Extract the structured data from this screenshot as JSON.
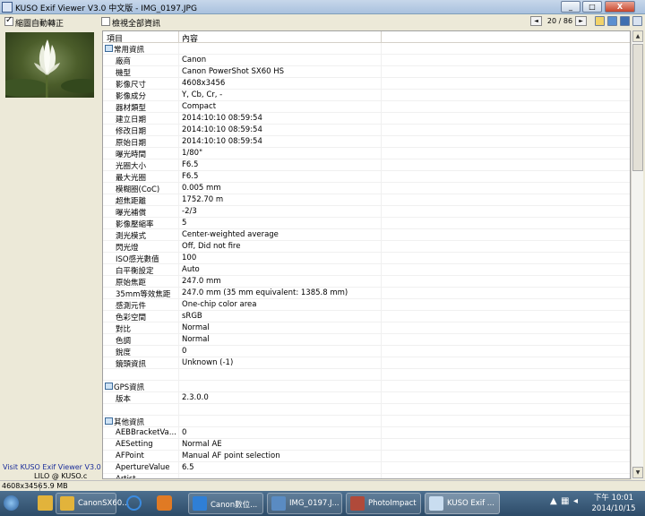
{
  "window": {
    "title": "KUSO Exif Viewer V3.0 中文版 - IMG_0197.JPG",
    "buttons": [
      "_",
      "□",
      "X"
    ]
  },
  "toolbar": {
    "auto_fit_label": "縮圖自動轉正",
    "show_all_label": "檢視全部資訊",
    "page_indicator": "20 / 86",
    "prev_label": "◄",
    "next_label": "►"
  },
  "table": {
    "headers": [
      "項目",
      "內容"
    ],
    "rows": [
      {
        "k": "常用資訊",
        "v": "",
        "section": true
      },
      {
        "k": "廠商",
        "v": "Canon"
      },
      {
        "k": "機型",
        "v": "Canon PowerShot SX60 HS"
      },
      {
        "k": "影像尺寸",
        "v": "4608x3456"
      },
      {
        "k": "影像成分",
        "v": "Y, Cb, Cr, -"
      },
      {
        "k": "器材類型",
        "v": "Compact"
      },
      {
        "k": "建立日期",
        "v": "2014:10:10 08:59:54"
      },
      {
        "k": "修改日期",
        "v": "2014:10:10 08:59:54"
      },
      {
        "k": "原始日期",
        "v": "2014:10:10 08:59:54"
      },
      {
        "k": "曝光時間",
        "v": "1/80\""
      },
      {
        "k": "光圈大小",
        "v": "F6.5"
      },
      {
        "k": "最大光圈",
        "v": "F6.5"
      },
      {
        "k": "模糊圈(CoC)",
        "v": "0.005 mm"
      },
      {
        "k": "超焦距離",
        "v": "1752.70 m"
      },
      {
        "k": "曝光補償",
        "v": "-2/3"
      },
      {
        "k": "影像壓縮率",
        "v": "5"
      },
      {
        "k": "測光模式",
        "v": "Center-weighted average"
      },
      {
        "k": "閃光燈",
        "v": "Off, Did not fire"
      },
      {
        "k": "ISO感光數值",
        "v": "100"
      },
      {
        "k": "白平衡設定",
        "v": "Auto"
      },
      {
        "k": "原始焦距",
        "v": "247.0 mm"
      },
      {
        "k": "35mm等效焦距",
        "v": "247.0 mm (35 mm equivalent: 1385.8 mm)"
      },
      {
        "k": "感測元件",
        "v": "One-chip color area"
      },
      {
        "k": "色彩空間",
        "v": "sRGB"
      },
      {
        "k": "對比",
        "v": "Normal"
      },
      {
        "k": "色調",
        "v": "Normal"
      },
      {
        "k": "銳度",
        "v": "0"
      },
      {
        "k": "鏡頭資訊",
        "v": "Unknown (-1)"
      },
      {
        "k": "",
        "v": ""
      },
      {
        "k": "GPS資訊",
        "v": "",
        "section": true
      },
      {
        "k": "版本",
        "v": "2.3.0.0"
      },
      {
        "k": "",
        "v": ""
      },
      {
        "k": "其他資訊",
        "v": "",
        "section": true
      },
      {
        "k": "AEBBracketVa...",
        "v": "0"
      },
      {
        "k": "AESetting",
        "v": "Normal AE"
      },
      {
        "k": "AFPoint",
        "v": "Manual AF point selection"
      },
      {
        "k": "ApertureValue",
        "v": "6.5"
      },
      {
        "k": "Artist",
        "v": ""
      }
    ]
  },
  "left_panel": {
    "visit_text": "Visit KUSO Exif Viewer V3.0",
    "lilo_text": "LILO @ KUSO.c"
  },
  "statusbar": {
    "dimensions": "4608x3456",
    "size": "5.9 MB"
  },
  "taskbar": {
    "items": [
      {
        "label": "CanonSX60...",
        "color": "#e2b33b"
      },
      {
        "label": "Canon數位...",
        "color": "#2f7fd6"
      },
      {
        "label": "IMG_0197.J...",
        "color": "#5a8bc2"
      },
      {
        "label": "PhotoImpact",
        "color": "#b04a3a"
      },
      {
        "label": "KUSO Exif ...",
        "color": "#c9ddf0"
      }
    ],
    "clock_time": "下午 10:01",
    "clock_date": "2014/10/15"
  }
}
